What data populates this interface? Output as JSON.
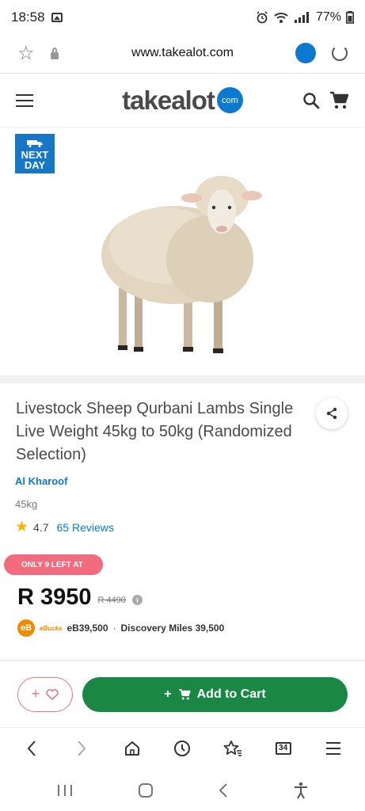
{
  "status_bar": {
    "time": "18:58",
    "battery": "77%"
  },
  "browser": {
    "url": "www.takealot.com"
  },
  "site": {
    "logo_text": "takealot",
    "logo_badge": "com"
  },
  "image": {
    "badge_line1": "NEXT",
    "badge_line2": "DAY",
    "alt": "sheep"
  },
  "product": {
    "title": "Livestock Sheep Qurbani Lambs Single Live Weight 45kg to 50kg (Randomized Selection)",
    "brand": "Al Kharoof",
    "weight": "45kg",
    "rating": "4.7",
    "reviews": "65 Reviews",
    "stock_badge": "ONLY 9 LEFT AT",
    "price": "R 3950",
    "old_price": "R 4490",
    "ebucks_logo": "eB",
    "ebucks_name": "eBucks",
    "ebucks_value": "eB39,500",
    "discovery_miles": "Discovery Miles 39,500"
  },
  "actions": {
    "wishlist_plus": "+",
    "add_to_cart": "Add to Cart"
  },
  "browser_nav": {
    "tab_count": "34"
  },
  "colors": {
    "brand_blue": "#0b79d0",
    "cart_green": "#1b8744",
    "badge_pink": "#f26b7f",
    "ebucks_orange": "#f08a00"
  }
}
